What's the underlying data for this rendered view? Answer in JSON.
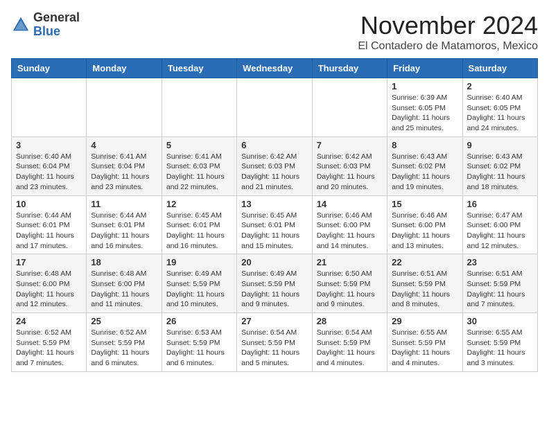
{
  "header": {
    "logo": {
      "general": "General",
      "blue": "Blue"
    },
    "title": "November 2024",
    "location": "El Contadero de Matamoros, Mexico"
  },
  "columns": [
    "Sunday",
    "Monday",
    "Tuesday",
    "Wednesday",
    "Thursday",
    "Friday",
    "Saturday"
  ],
  "weeks": [
    [
      {
        "day": "",
        "info": ""
      },
      {
        "day": "",
        "info": ""
      },
      {
        "day": "",
        "info": ""
      },
      {
        "day": "",
        "info": ""
      },
      {
        "day": "",
        "info": ""
      },
      {
        "day": "1",
        "info": "Sunrise: 6:39 AM\nSunset: 6:05 PM\nDaylight: 11 hours and 25 minutes."
      },
      {
        "day": "2",
        "info": "Sunrise: 6:40 AM\nSunset: 6:05 PM\nDaylight: 11 hours and 24 minutes."
      }
    ],
    [
      {
        "day": "3",
        "info": "Sunrise: 6:40 AM\nSunset: 6:04 PM\nDaylight: 11 hours and 23 minutes."
      },
      {
        "day": "4",
        "info": "Sunrise: 6:41 AM\nSunset: 6:04 PM\nDaylight: 11 hours and 23 minutes."
      },
      {
        "day": "5",
        "info": "Sunrise: 6:41 AM\nSunset: 6:03 PM\nDaylight: 11 hours and 22 minutes."
      },
      {
        "day": "6",
        "info": "Sunrise: 6:42 AM\nSunset: 6:03 PM\nDaylight: 11 hours and 21 minutes."
      },
      {
        "day": "7",
        "info": "Sunrise: 6:42 AM\nSunset: 6:03 PM\nDaylight: 11 hours and 20 minutes."
      },
      {
        "day": "8",
        "info": "Sunrise: 6:43 AM\nSunset: 6:02 PM\nDaylight: 11 hours and 19 minutes."
      },
      {
        "day": "9",
        "info": "Sunrise: 6:43 AM\nSunset: 6:02 PM\nDaylight: 11 hours and 18 minutes."
      }
    ],
    [
      {
        "day": "10",
        "info": "Sunrise: 6:44 AM\nSunset: 6:01 PM\nDaylight: 11 hours and 17 minutes."
      },
      {
        "day": "11",
        "info": "Sunrise: 6:44 AM\nSunset: 6:01 PM\nDaylight: 11 hours and 16 minutes."
      },
      {
        "day": "12",
        "info": "Sunrise: 6:45 AM\nSunset: 6:01 PM\nDaylight: 11 hours and 16 minutes."
      },
      {
        "day": "13",
        "info": "Sunrise: 6:45 AM\nSunset: 6:01 PM\nDaylight: 11 hours and 15 minutes."
      },
      {
        "day": "14",
        "info": "Sunrise: 6:46 AM\nSunset: 6:00 PM\nDaylight: 11 hours and 14 minutes."
      },
      {
        "day": "15",
        "info": "Sunrise: 6:46 AM\nSunset: 6:00 PM\nDaylight: 11 hours and 13 minutes."
      },
      {
        "day": "16",
        "info": "Sunrise: 6:47 AM\nSunset: 6:00 PM\nDaylight: 11 hours and 12 minutes."
      }
    ],
    [
      {
        "day": "17",
        "info": "Sunrise: 6:48 AM\nSunset: 6:00 PM\nDaylight: 11 hours and 12 minutes."
      },
      {
        "day": "18",
        "info": "Sunrise: 6:48 AM\nSunset: 6:00 PM\nDaylight: 11 hours and 11 minutes."
      },
      {
        "day": "19",
        "info": "Sunrise: 6:49 AM\nSunset: 5:59 PM\nDaylight: 11 hours and 10 minutes."
      },
      {
        "day": "20",
        "info": "Sunrise: 6:49 AM\nSunset: 5:59 PM\nDaylight: 11 hours and 9 minutes."
      },
      {
        "day": "21",
        "info": "Sunrise: 6:50 AM\nSunset: 5:59 PM\nDaylight: 11 hours and 9 minutes."
      },
      {
        "day": "22",
        "info": "Sunrise: 6:51 AM\nSunset: 5:59 PM\nDaylight: 11 hours and 8 minutes."
      },
      {
        "day": "23",
        "info": "Sunrise: 6:51 AM\nSunset: 5:59 PM\nDaylight: 11 hours and 7 minutes."
      }
    ],
    [
      {
        "day": "24",
        "info": "Sunrise: 6:52 AM\nSunset: 5:59 PM\nDaylight: 11 hours and 7 minutes."
      },
      {
        "day": "25",
        "info": "Sunrise: 6:52 AM\nSunset: 5:59 PM\nDaylight: 11 hours and 6 minutes."
      },
      {
        "day": "26",
        "info": "Sunrise: 6:53 AM\nSunset: 5:59 PM\nDaylight: 11 hours and 6 minutes."
      },
      {
        "day": "27",
        "info": "Sunrise: 6:54 AM\nSunset: 5:59 PM\nDaylight: 11 hours and 5 minutes."
      },
      {
        "day": "28",
        "info": "Sunrise: 6:54 AM\nSunset: 5:59 PM\nDaylight: 11 hours and 4 minutes."
      },
      {
        "day": "29",
        "info": "Sunrise: 6:55 AM\nSunset: 5:59 PM\nDaylight: 11 hours and 4 minutes."
      },
      {
        "day": "30",
        "info": "Sunrise: 6:55 AM\nSunset: 5:59 PM\nDaylight: 11 hours and 3 minutes."
      }
    ]
  ]
}
